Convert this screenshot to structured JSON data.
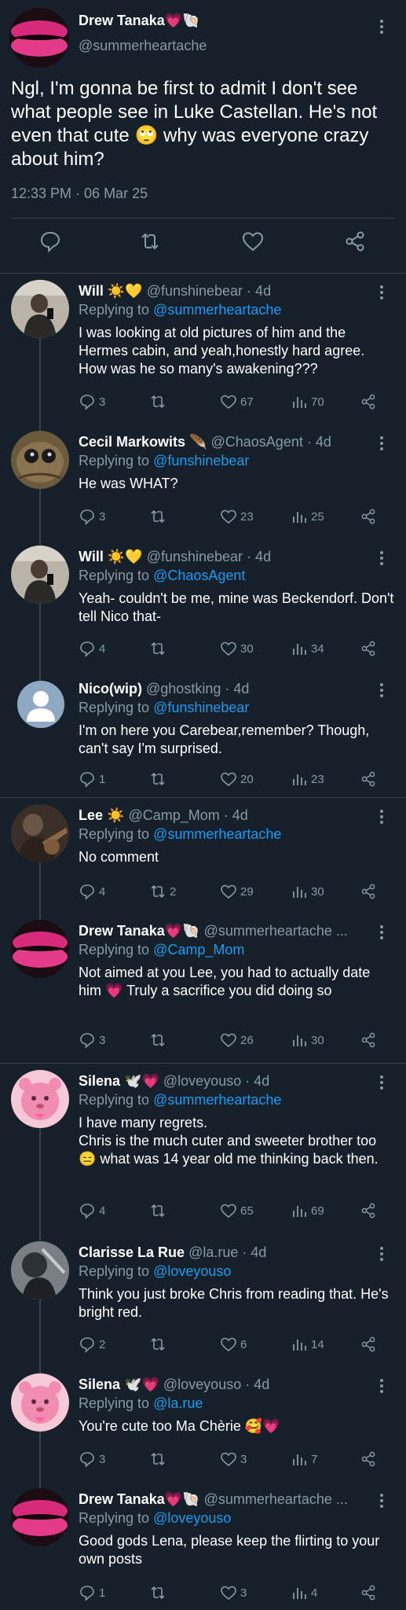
{
  "main": {
    "name": "Drew Tanaka",
    "name_emoji": "💗🐚",
    "handle": "@summerheartache",
    "text": "Ngl, I'm gonna be first to admit I don't see what people see in Luke Castellan. He's not even that cute 🙄 why was everyone crazy about him?",
    "timestamp": "12:33 PM · 06 Mar 25"
  },
  "replies": [
    {
      "name": "Will",
      "name_emoji": "☀️💛",
      "handle": "@funshinebear · 4d",
      "replying_label": "Replying to",
      "replying_to": "@summerheartache",
      "text": "I was looking at old pictures of him and the Hermes cabin, and yeah,honestly hard agree. How was he so many's awakening???",
      "replies": "3",
      "retweets": "",
      "likes": "67",
      "views": "70"
    },
    {
      "name": "Cecil Markowits",
      "name_emoji": "🪶",
      "handle": "@ChaosAgent · 4d",
      "replying_label": "Replying to",
      "replying_to": "@funshinebear",
      "text": "He was WHAT?",
      "replies": "3",
      "retweets": "",
      "likes": "23",
      "views": "25"
    },
    {
      "name": "Will",
      "name_emoji": "☀️💛",
      "handle": "@funshinebear · 4d",
      "replying_label": "Replying to",
      "replying_to": "@ChaosAgent",
      "text": "Yeah- couldn't be me, mine was Beckendorf. Don't tell Nico that-",
      "replies": "4",
      "retweets": "",
      "likes": "30",
      "views": "34"
    },
    {
      "name": "Nico(wip)",
      "name_emoji": "",
      "handle": "@ghostking · 4d",
      "replying_label": "Replying to",
      "replying_to": "@funshinebear",
      "text": "I'm on here you Carebear,remember? Though, can't say I'm surprised.",
      "replies": "1",
      "retweets": "",
      "likes": "20",
      "views": "23"
    },
    {
      "name": "Lee",
      "name_emoji": "☀️",
      "handle": "@Camp_Mom · 4d",
      "replying_label": "Replying to",
      "replying_to": "@summerheartache",
      "text": "No comment",
      "replies": "4",
      "retweets": "2",
      "likes": "29",
      "views": "30"
    },
    {
      "name": "Drew Tanaka",
      "name_emoji": "💗🐚",
      "handle": "@summerheartache ...",
      "replying_label": "Replying to",
      "replying_to": "@Camp_Mom",
      "text": "Not aimed at you Lee, you had to actually date him 💗 Truly a sacrifice you did doing so",
      "replies": "3",
      "retweets": "",
      "likes": "26",
      "views": "30"
    },
    {
      "name": "Silena",
      "name_emoji": "🕊️💗",
      "handle": "@loveyouso · 4d",
      "replying_label": "Replying to",
      "replying_to": "@summerheartache",
      "text": "I have many regrets.\nChris is the much cuter and sweeter brother too 😑 what was 14 year old me thinking back then.",
      "replies": "4",
      "retweets": "",
      "likes": "65",
      "views": "69"
    },
    {
      "name": "Clarisse La Rue",
      "name_emoji": "",
      "handle": "@la.rue · 4d",
      "replying_label": "Replying to",
      "replying_to": "@loveyouso",
      "text": "Think you just broke Chris from reading that. He's bright red.",
      "replies": "2",
      "retweets": "",
      "likes": "6",
      "views": "14"
    },
    {
      "name": "Silena",
      "name_emoji": "🕊️💗",
      "handle": "@loveyouso · 4d",
      "replying_label": "Replying to",
      "replying_to": "@la.rue",
      "text": "You're cute too Ma Chèrie 🥰💗",
      "replies": "3",
      "retweets": "",
      "likes": "3",
      "views": "7"
    },
    {
      "name": "Drew Tanaka",
      "name_emoji": "💗🐚",
      "handle": "@summerheartache ...",
      "replying_label": "Replying to",
      "replying_to": "@loveyouso",
      "text": "Good gods Lena, please keep the flirting to your own posts",
      "replies": "1",
      "retweets": "",
      "likes": "3",
      "views": "4"
    }
  ],
  "icons": {
    "reply": "reply-icon",
    "retweet": "retweet-icon",
    "like": "heart-icon",
    "views": "views-icon",
    "share": "share-icon",
    "more": "more-icon"
  },
  "colors": {
    "background": "#15202b",
    "link": "#1d9bf0",
    "muted": "#8899a6",
    "divider": "#38444d"
  }
}
